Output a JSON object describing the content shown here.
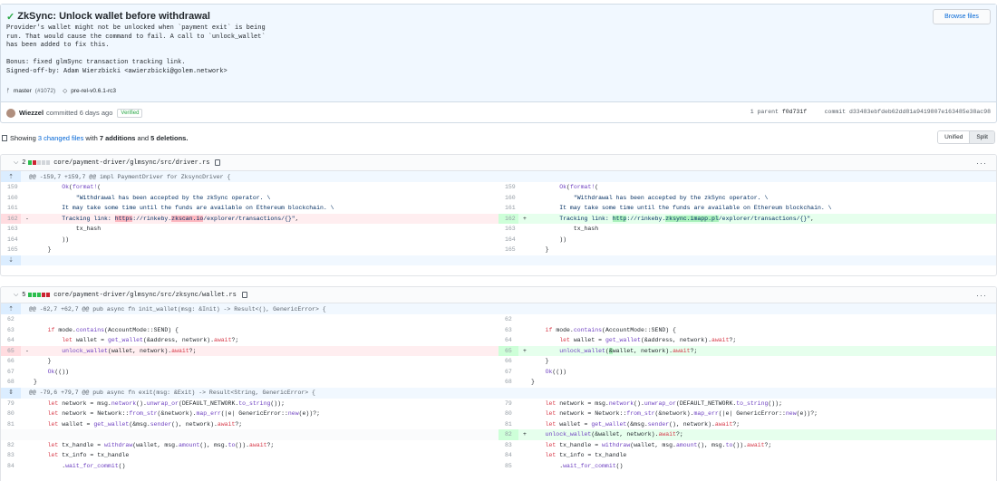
{
  "commit": {
    "title": "ZkSync: Unlock wallet before withdrawal",
    "description": "Provider's wallet might not be unlocked when `payment exit` is being\nrun. That would cause the command to fail. A call to `unlock_wallet`\nhas been added to fix this.\n\nBonus: fixed glmSync transaction tracking link.\nSigned-off-by: Adam Wierzbicki <awierzbicki@golem.network>",
    "browse_files": "Browse files",
    "branch": "master",
    "pr": "(#1072)",
    "tag": "pre-rel-v0.6.1-rc3",
    "author": "Wiezzel",
    "committed_text": "committed 6 days ago",
    "verified": "Verified",
    "parent_label": "1 parent",
    "parent_sha": "f0d731f",
    "commit_label": "commit",
    "commit_sha": "d33483ebfdeb62dd81a9419807e163485e38ac98"
  },
  "toolbar": {
    "showing": "Showing",
    "changed_files": "3 changed files",
    "with": "with",
    "additions": "7 additions",
    "and": "and",
    "deletions": "5 deletions.",
    "unified": "Unified",
    "split": "Split"
  },
  "files": [
    {
      "count": "2",
      "path": "core/payment-driver/glmsync/src/driver.rs",
      "hunk": "@@ -159,7 +159,7 @@ impl PaymentDriver for ZksyncDriver {"
    },
    {
      "count": "5",
      "path": "core/payment-driver/glmsync/src/zksync/wallet.rs",
      "hunk1": "@@ -62,7 +62,7 @@ pub async fn init_wallet(msg: &Init) -> Result<(), GenericError> {",
      "hunk2": "@@ -79,6 +79,7 @@ pub async fn exit(msg: &Exit) -> Result<String, GenericError> {"
    }
  ],
  "icons": {
    "check": "check-icon",
    "branch": "branch-icon",
    "tag": "tag-icon",
    "copy": "copy-icon",
    "chevron": "chevron-down-icon",
    "kebab": "kebab-icon"
  },
  "colors": {
    "addition": "#e6ffed",
    "deletion": "#ffeef0",
    "hunk": "#f1f8ff",
    "link": "#0366d6",
    "verified": "#28a745"
  }
}
